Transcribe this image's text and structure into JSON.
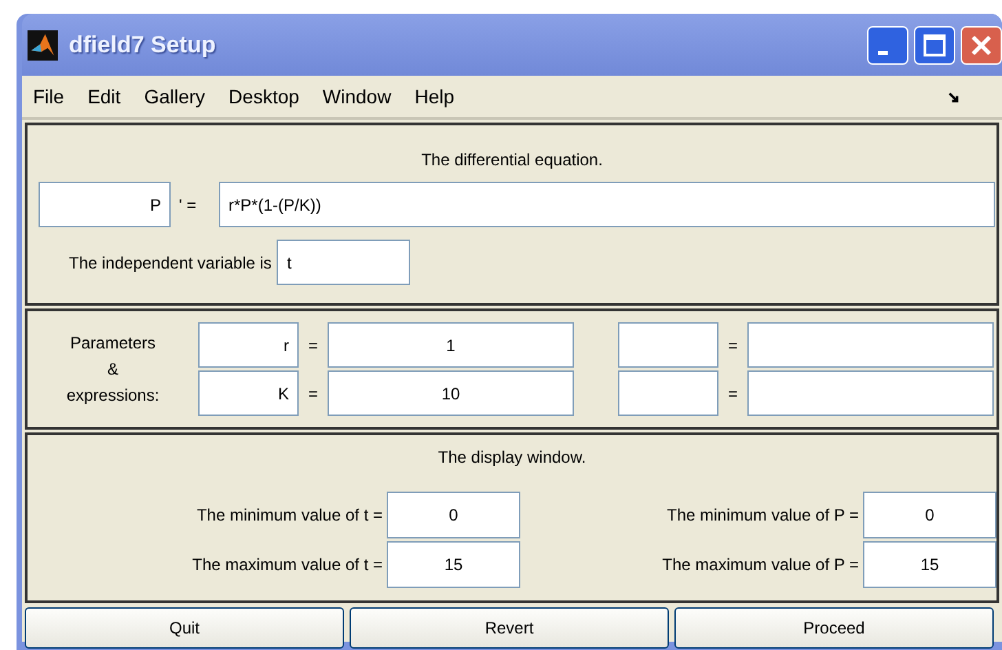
{
  "window": {
    "title": "dfield7 Setup"
  },
  "menu": [
    "File",
    "Edit",
    "Gallery",
    "Desktop",
    "Window",
    "Help"
  ],
  "equation": {
    "heading": "The differential equation.",
    "variable": "P",
    "prime_label": "' =",
    "expression": "r*P*(1-(P/K))",
    "independent_label": "The independent variable is",
    "independent": "t"
  },
  "parameters": {
    "label_lines": [
      "Parameters",
      "&",
      "expressions:"
    ],
    "entries": [
      {
        "name": "r",
        "equals": "=",
        "value": "1"
      },
      {
        "name": "K",
        "equals": "=",
        "value": "10"
      },
      {
        "equals": "="
      },
      {
        "equals": "="
      }
    ]
  },
  "display": {
    "heading": "The display window.",
    "fields": [
      {
        "label": "The minimum value of t =",
        "value": "0"
      },
      {
        "label": "The minimum value of P =",
        "value": "0"
      },
      {
        "label": "The maximum value of t =",
        "value": "15"
      },
      {
        "label": "The maximum value of P =",
        "value": "15"
      }
    ]
  },
  "buttons": [
    "Quit",
    "Revert",
    "Proceed"
  ]
}
